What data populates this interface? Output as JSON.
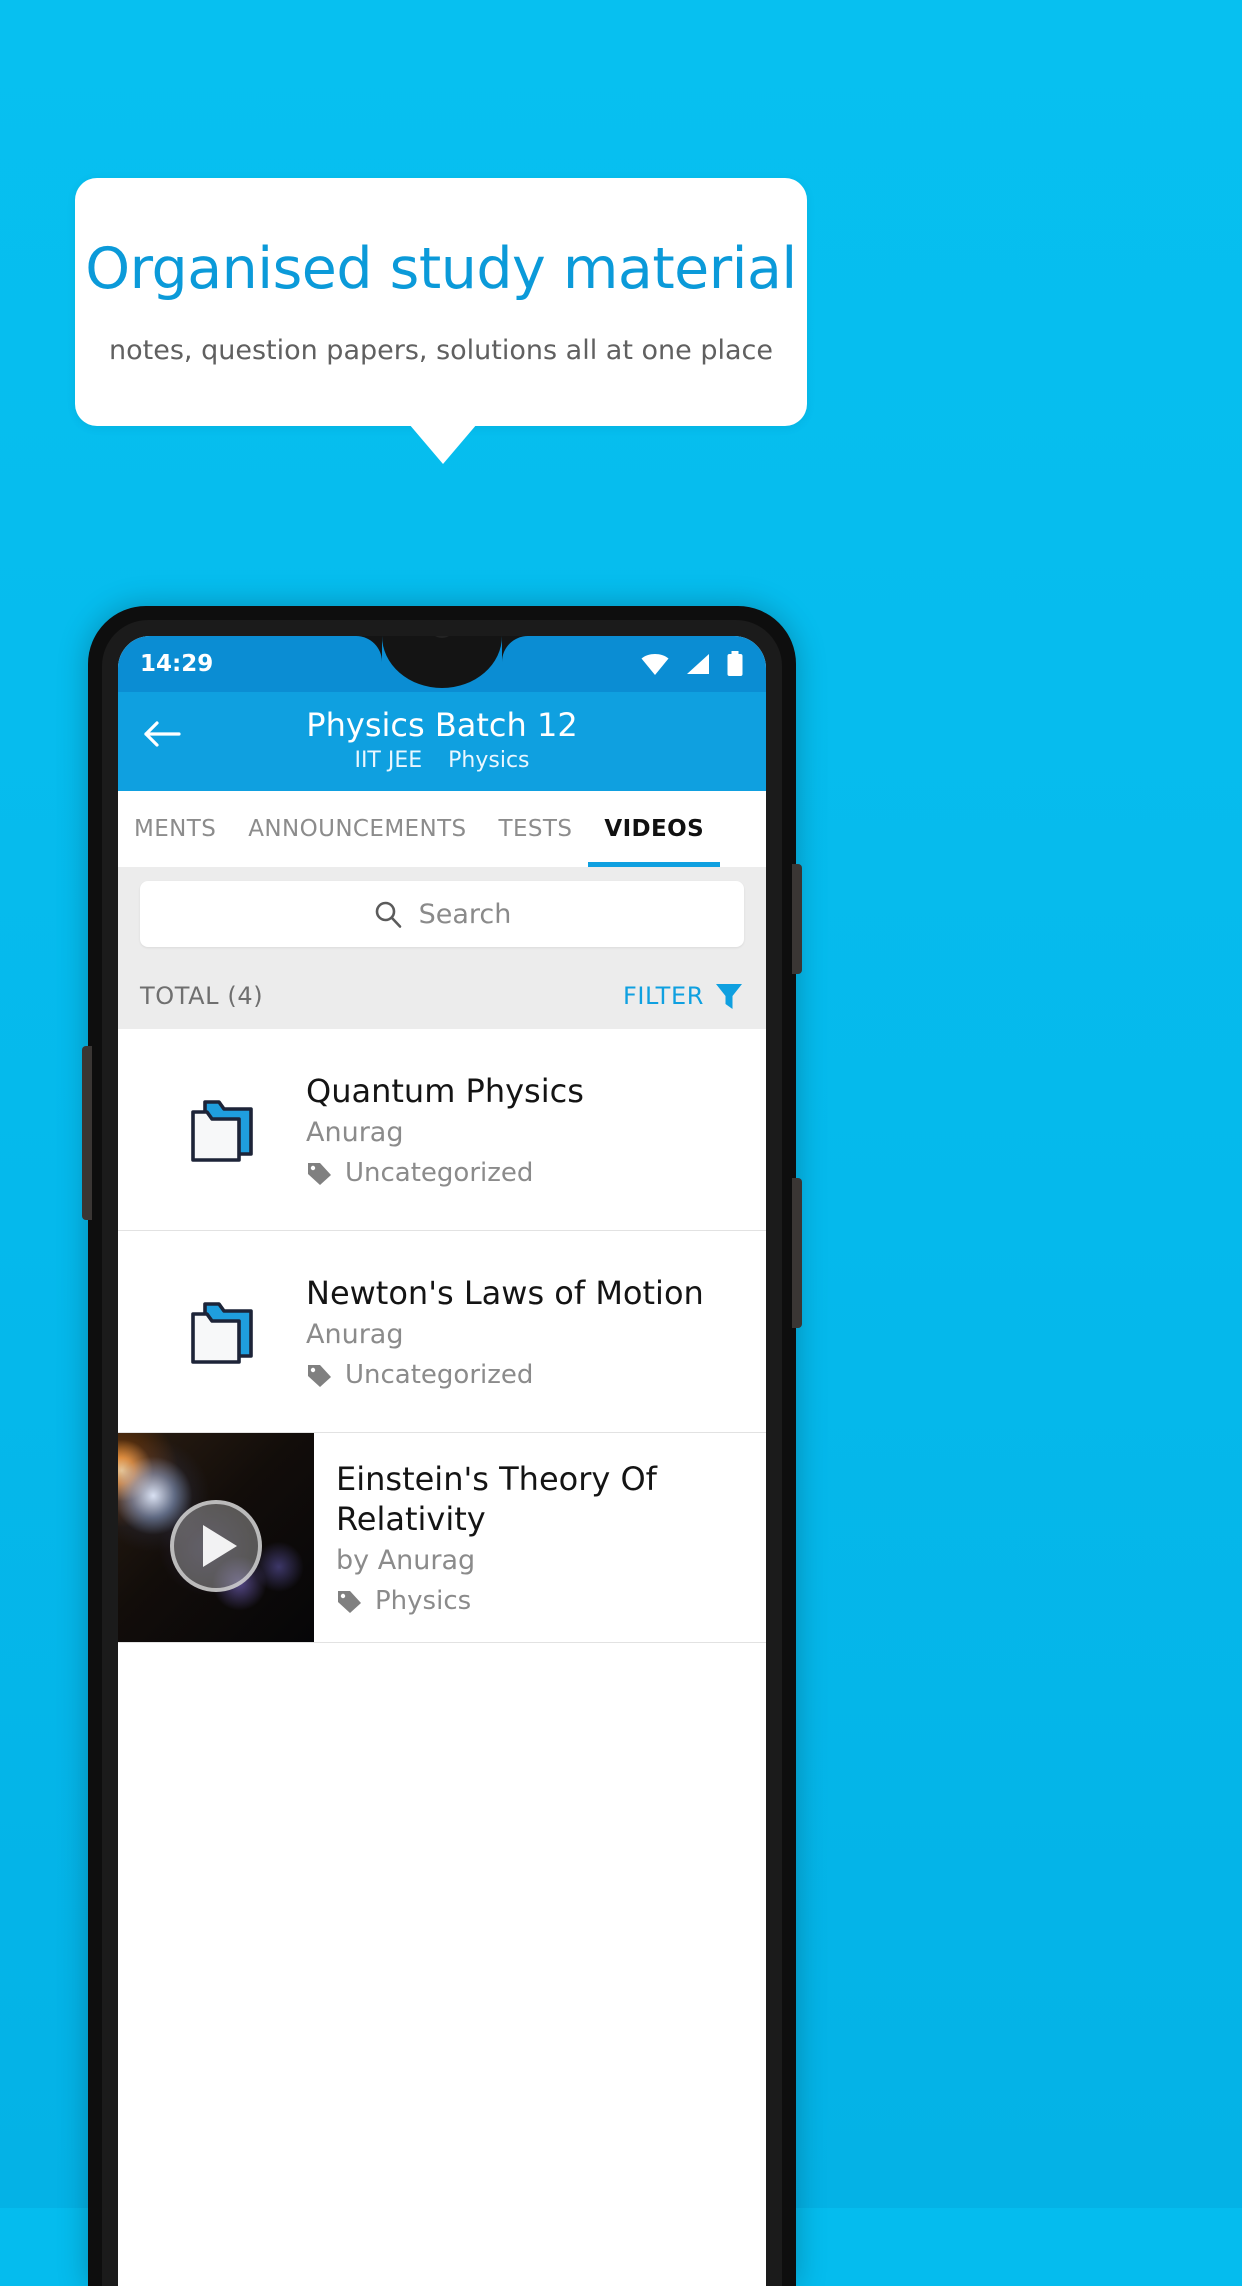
{
  "promo": {
    "title": "Organised study material",
    "subtitle": "notes, question papers, solutions all at one place",
    "background_color": "#05bcee",
    "title_color": "#0b9ad9",
    "bubble_color": "#ffffff"
  },
  "phone": {
    "statusbar": {
      "time": "14:29",
      "icons": [
        "wifi-icon",
        "signal-icon",
        "battery-icon"
      ],
      "background_color": "#0b8dd3"
    },
    "appbar": {
      "back_icon": "back-arrow-icon",
      "title": "Physics Batch 12",
      "subtitle_exam": "IIT JEE",
      "subtitle_subject": "Physics",
      "background_color": "#0fa0e0"
    },
    "tabs": [
      {
        "label": "MENTS",
        "active": false
      },
      {
        "label": "ANNOUNCEMENTS",
        "active": false
      },
      {
        "label": "TESTS",
        "active": false
      },
      {
        "label": "VIDEOS",
        "active": true
      }
    ],
    "search": {
      "placeholder": "Search",
      "value": "",
      "icon": "search-icon"
    },
    "meta": {
      "total_label": "TOTAL (4)",
      "filter_label": "FILTER",
      "filter_icon": "funnel-icon",
      "accent_color": "#0fa0e0"
    },
    "list": [
      {
        "type": "folder",
        "icon": "folder-icon",
        "title": "Quantum Physics",
        "author": "Anurag",
        "tag_icon": "tag-icon",
        "tag": "Uncategorized"
      },
      {
        "type": "folder",
        "icon": "folder-icon",
        "title": "Newton's Laws of Motion",
        "author": "Anurag",
        "tag_icon": "tag-icon",
        "tag": "Uncategorized"
      },
      {
        "type": "video",
        "icon": "play-icon",
        "title": "Einstein's Theory Of Relativity",
        "author": "by Anurag",
        "tag_icon": "tag-icon",
        "tag": "Physics"
      }
    ]
  }
}
